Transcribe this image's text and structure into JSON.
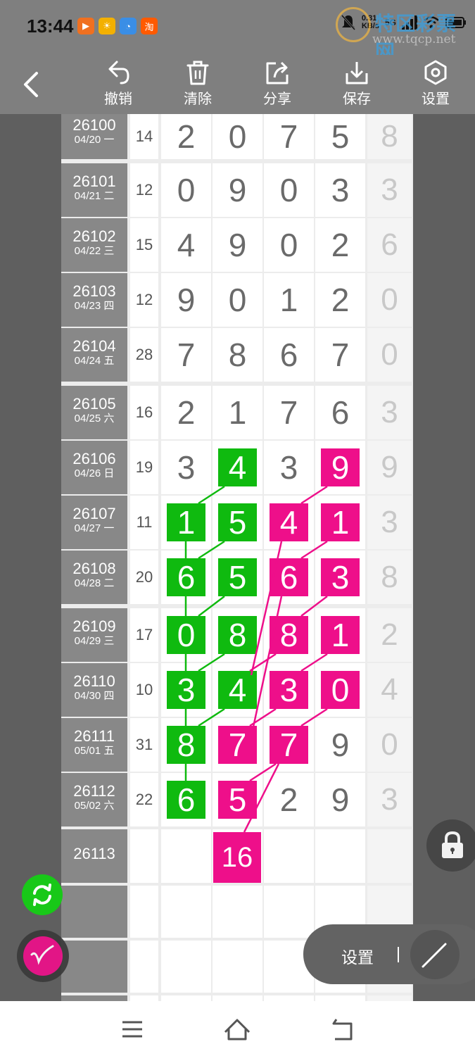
{
  "status_bar": {
    "time": "13:44",
    "app_icons": [
      {
        "name": "video-app-icon",
        "color": "#f07020",
        "glyph": "▶"
      },
      {
        "name": "sun-app-icon",
        "color": "#f3b000",
        "glyph": "☀"
      },
      {
        "name": "chat-app-icon",
        "color": "#3a8ee6",
        "glyph": "◔"
      },
      {
        "name": "taobao-app-icon",
        "color": "#ff5a00",
        "glyph": "淘"
      }
    ],
    "net_rate_value": "0.31",
    "net_rate_unit": "KB/s",
    "signal_label": "5G",
    "watermark_title": "特区彩票网",
    "watermark_url": "www.tqcp.net"
  },
  "toolbar": {
    "buttons": [
      {
        "label": "撤销",
        "icon": "undo-icon"
      },
      {
        "label": "清除",
        "icon": "trash-icon"
      },
      {
        "label": "分享",
        "icon": "share-icon"
      },
      {
        "label": "保存",
        "icon": "download-icon"
      },
      {
        "label": "设置",
        "icon": "settings-hexagon-icon"
      }
    ]
  },
  "board": {
    "rows": [
      {
        "id": "26100",
        "date": "04/20 一",
        "sum": "14",
        "d": [
          "2",
          "0",
          "7",
          "5"
        ],
        "last": "8"
      },
      {
        "id": "26101",
        "date": "04/21 二",
        "sum": "12",
        "d": [
          "0",
          "9",
          "0",
          "3"
        ],
        "last": "3"
      },
      {
        "id": "26102",
        "date": "04/22 三",
        "sum": "15",
        "d": [
          "4",
          "9",
          "0",
          "2"
        ],
        "last": "6"
      },
      {
        "id": "26103",
        "date": "04/23 四",
        "sum": "12",
        "d": [
          "9",
          "0",
          "1",
          "2"
        ],
        "last": "0"
      },
      {
        "id": "26104",
        "date": "04/24 五",
        "sum": "28",
        "d": [
          "7",
          "8",
          "6",
          "7"
        ],
        "last": "0"
      },
      {
        "id": "26105",
        "date": "04/25 六",
        "sum": "16",
        "d": [
          "2",
          "1",
          "7",
          "6"
        ],
        "last": "3"
      },
      {
        "id": "26106",
        "date": "04/26 日",
        "sum": "19",
        "d": [
          "3",
          "4",
          "3",
          "9"
        ],
        "last": "9"
      },
      {
        "id": "26107",
        "date": "04/27 一",
        "sum": "11",
        "d": [
          "1",
          "5",
          "4",
          "1"
        ],
        "last": "3"
      },
      {
        "id": "26108",
        "date": "04/28 二",
        "sum": "20",
        "d": [
          "6",
          "5",
          "6",
          "3"
        ],
        "last": "8"
      },
      {
        "id": "26109",
        "date": "04/29 三",
        "sum": "17",
        "d": [
          "0",
          "8",
          "8",
          "1"
        ],
        "last": "2"
      },
      {
        "id": "26110",
        "date": "04/30 四",
        "sum": "10",
        "d": [
          "3",
          "4",
          "3",
          "0"
        ],
        "last": "4"
      },
      {
        "id": "26111",
        "date": "05/01 五",
        "sum": "31",
        "d": [
          "8",
          "7",
          "7",
          "9"
        ],
        "last": "0"
      },
      {
        "id": "26112",
        "date": "05/02 六",
        "sum": "22",
        "d": [
          "6",
          "5",
          "2",
          "9"
        ],
        "last": "3"
      }
    ],
    "highlights": [
      [
        null,
        null,
        null,
        null
      ],
      [
        null,
        null,
        null,
        null
      ],
      [
        null,
        null,
        null,
        null
      ],
      [
        null,
        null,
        null,
        null
      ],
      [
        null,
        null,
        null,
        null
      ],
      [
        null,
        null,
        null,
        null
      ],
      [
        null,
        "green",
        null,
        "pink"
      ],
      [
        "green",
        "green",
        "pink",
        "pink"
      ],
      [
        "green",
        "green",
        "pink",
        "pink"
      ],
      [
        "green",
        "green",
        "pink",
        "pink"
      ],
      [
        "green",
        "green",
        "pink",
        "pink"
      ],
      [
        "green",
        "pink",
        "pink",
        null
      ],
      [
        "green",
        "pink",
        null,
        null
      ]
    ],
    "next_row": {
      "id": "26113",
      "prediction": "16"
    },
    "colors": {
      "green": "#0fba0f",
      "pink": "#ee0f8a"
    }
  },
  "floating": {
    "pill_label": "设置",
    "refresh_icon": "refresh-icon",
    "pen_icon": "pen-icon",
    "lock_icon": "lock-icon",
    "line_tool_icon": "line-tool-icon"
  },
  "nav_bar": {
    "icons": [
      "menu-icon",
      "home-icon",
      "back-return-icon"
    ]
  }
}
